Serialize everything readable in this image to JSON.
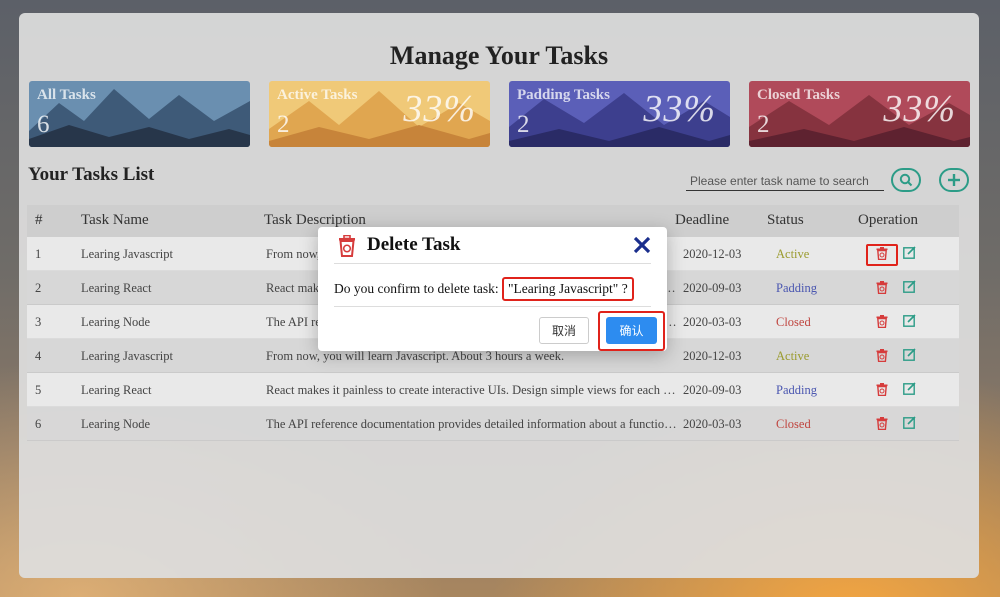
{
  "page_title": "Manage Your Tasks",
  "cards": [
    {
      "title": "All Tasks",
      "count": "6",
      "percent": ""
    },
    {
      "title": "Active Tasks",
      "count": "2",
      "percent": "33%"
    },
    {
      "title": "Padding Tasks",
      "count": "2",
      "percent": "33%"
    },
    {
      "title": "Closed Tasks",
      "count": "2",
      "percent": "33%"
    }
  ],
  "list_title": "Your Tasks List",
  "search": {
    "placeholder": "Please enter task name to search"
  },
  "icons": {
    "search": "search-icon",
    "add": "plus-icon",
    "delete": "trash-icon",
    "edit": "edit-icon",
    "close": "close-icon"
  },
  "table": {
    "headers": {
      "num": "#",
      "name": "Task Name",
      "desc": "Task Description",
      "deadline": "Deadline",
      "status": "Status",
      "operation": "Operation"
    },
    "rows": [
      {
        "num": "1",
        "name": "Learing Javascript",
        "desc": "From now, you will learn Javascript. About 3 hours a week.",
        "deadline": "2020-12-03",
        "status": "Active"
      },
      {
        "num": "2",
        "name": "Learing React",
        "desc": "React makes it painless to create interactive UIs. Design simple views for each state in your application.",
        "deadline": "2020-09-03",
        "status": "Padding"
      },
      {
        "num": "3",
        "name": "Learing Node",
        "desc": "The API reference documentation provides detailed information about a function or object in Node.js.",
        "deadline": "2020-03-03",
        "status": "Closed"
      },
      {
        "num": "4",
        "name": "Learing Javascript",
        "desc": "From now, you will learn Javascript. About 3 hours a week.",
        "deadline": "2020-12-03",
        "status": "Active"
      },
      {
        "num": "5",
        "name": "Learing React",
        "desc": "React makes it painless to create interactive UIs. Design simple views for each state in your application.",
        "deadline": "2020-09-03",
        "status": "Padding"
      },
      {
        "num": "6",
        "name": "Learing Node",
        "desc": "The API reference documentation provides detailed information about a function or object in Node.js.",
        "deadline": "2020-03-03",
        "status": "Closed"
      }
    ]
  },
  "modal": {
    "title": "Delete Task",
    "message_prefix": "Do you confirm to delete task: ",
    "task_quoted": "\"Learing Javascript\" ?",
    "cancel_label": "取消",
    "ok_label": "确认"
  },
  "colors": {
    "accent": "#2c9c87",
    "primary": "#2d8cf0",
    "danger": "#d63c3c",
    "highlight": "#e0231b"
  }
}
